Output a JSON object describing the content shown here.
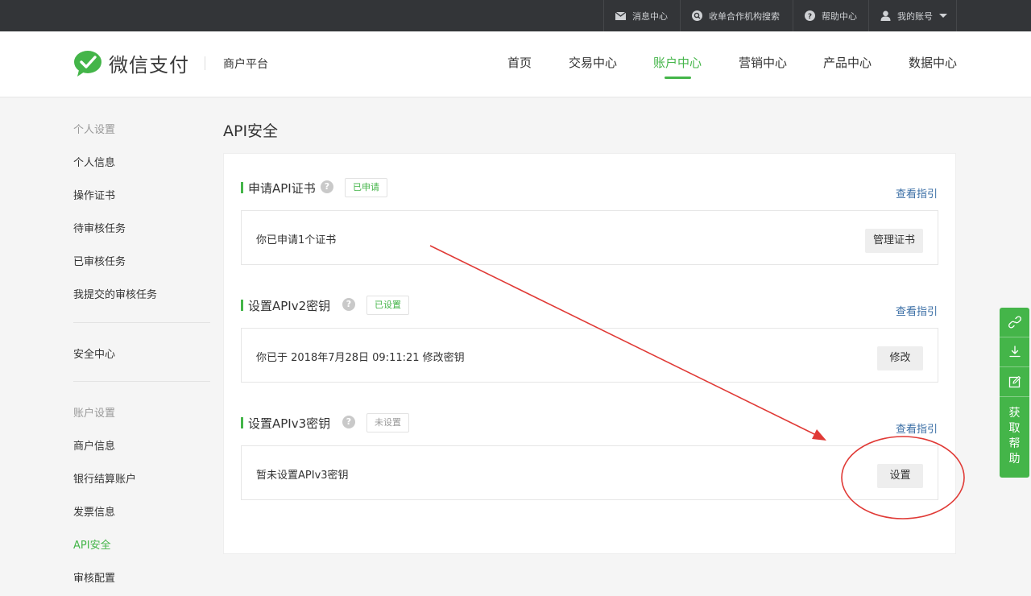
{
  "topbar": {
    "items": [
      "消息中心",
      "收单合作机构搜索",
      "帮助中心",
      "我的账号"
    ]
  },
  "header": {
    "logo_text": "微信支付",
    "platform": "商户平台",
    "nav": [
      "首页",
      "交易中心",
      "账户中心",
      "营销中心",
      "产品中心",
      "数据中心"
    ],
    "active_nav": "账户中心",
    "accent_color": "#44b549"
  },
  "sidebar": {
    "group1_title": "个人设置",
    "group1_items": [
      "个人信息",
      "操作证书",
      "待审核任务",
      "已审核任务",
      "我提交的审核任务"
    ],
    "security": "安全中心",
    "group2_title": "账户设置",
    "group2_items": [
      "商户信息",
      "银行结算账户",
      "发票信息",
      "API安全",
      "审核配置"
    ],
    "active_item": "API安全"
  },
  "main": {
    "title": "API安全",
    "sections": [
      {
        "title": "申请API证书",
        "help": "?",
        "badge": "已申请",
        "guide": "查看指引",
        "text": "你已申请1个证书",
        "button": "管理证书"
      },
      {
        "title": "设置APIv2密钥",
        "help": "?",
        "badge": "已设置",
        "guide": "查看指引",
        "text": "你已于 2018年7月28日 09:11:21 修改密钥",
        "button": "修改"
      },
      {
        "title": "设置APIv3密钥",
        "help": "?",
        "badge": "未设置",
        "guide": "查看指引",
        "text": "暂未设置APIv3密钥",
        "button": "设置"
      }
    ]
  },
  "float_toolbar": {
    "icons": [
      "link-icon",
      "download-icon",
      "edit-icon"
    ],
    "help_label": "获取帮助",
    "help_chars": [
      "获",
      "取",
      "帮",
      "助"
    ]
  },
  "annotation": {
    "color": "#e03a36",
    "shapes": [
      "arrow",
      "circle"
    ]
  }
}
